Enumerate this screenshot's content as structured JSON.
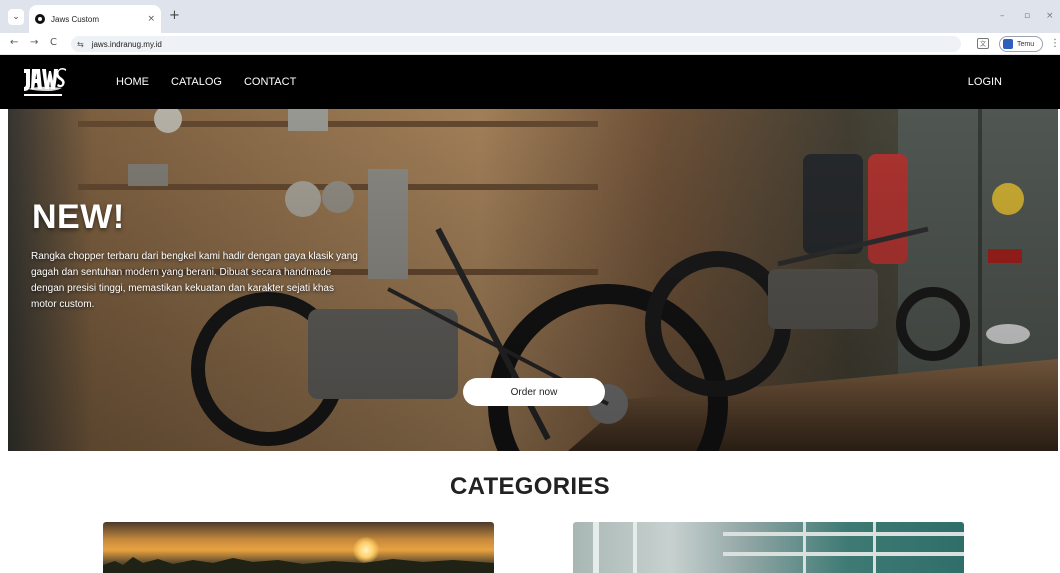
{
  "browser": {
    "tab_title": "Jaws Custom",
    "tab_close": "×",
    "new_tab": "+",
    "url": "jaws.indranug.my.id",
    "profile_name": "Temu",
    "minimize": "–",
    "restore": "▫",
    "close": "×",
    "back": "←",
    "forward": "→",
    "reload": "C",
    "menu": "⋮",
    "tab_menu": "⌄",
    "tune": "⇆",
    "translate": "文"
  },
  "site": {
    "logo_alt": "Jaws Custom",
    "nav": {
      "home": "HOME",
      "catalog": "CATALOG",
      "contact": "CONTACT",
      "login": "LOGIN"
    },
    "hero": {
      "title": "NEW!",
      "description": "Rangka chopper terbaru dari bengkel kami hadir dengan gaya klasik yang gagah dan sentuhan modern yang berani. Dibuat secara handmade dengan presisi tinggi, memastikan kekuatan dan karakter sejati khas motor custom.",
      "cta": "Order now"
    },
    "categories": {
      "heading": "CATEGORIES"
    }
  },
  "colors": {
    "header_bg": "#000000",
    "hero_overlay": "rgba(0,0,0,0.35)",
    "cta_bg": "#ffffff"
  }
}
